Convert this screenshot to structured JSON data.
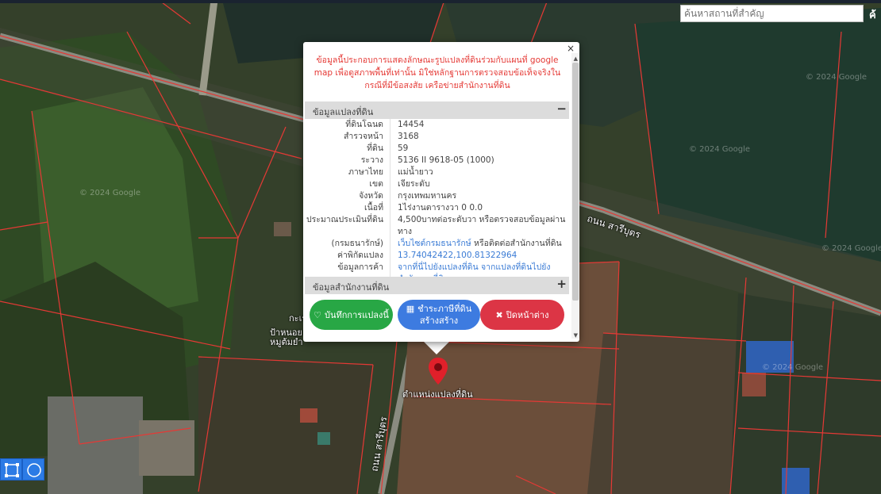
{
  "search": {
    "placeholder": "ค้นหาสถานที่สำคัญ",
    "button_label": "ค้"
  },
  "map": {
    "road_labels": [
      "ถนน สารีบุตร",
      "ถนน สารีบุตร"
    ],
    "place_labels": [
      "ป้าหนอย",
      "หมูต้มยำ",
      "กะเร"
    ],
    "watermarks": [
      "© 2024 Google",
      "© 2024 Google",
      "© 2024 Google",
      "© 2024 Google",
      "© 2024 Google"
    ],
    "marker_label": "ตำแหน่งแปลงที่ดิน"
  },
  "tools": {
    "rect_icon": "square-draw-icon",
    "circle_icon": "circle-draw-icon"
  },
  "popup": {
    "close_label": "×",
    "disclaimer": "ข้อมูลนี้ประกอบการแสดงลักษณะรูปแปลงที่ดินร่วมกับแผนที่ google map เพื่อดูสภาพพื้นที่เท่านั้น มิใช่หลักฐานการตรวจสอบข้อเท็จจริงในกรณีที่มีข้อสงสัย เครือข่ายสำนักงานที่ดิน",
    "section1_title": "ข้อมูลแปลงที่ดิน",
    "section1_toggle": "−",
    "section2_title": "ข้อมูลสำนักงานที่ดิน",
    "section2_toggle": "+",
    "rows": [
      {
        "label": "ที่ดินโฉนด",
        "value": "14454"
      },
      {
        "label": "สำรวจหน้า",
        "value": "3168"
      },
      {
        "label": "ที่ดิน",
        "value": "59"
      },
      {
        "label": "ระวาง",
        "value": "5136 II 9618-05 (1000)"
      },
      {
        "label": "ภาษาไทย",
        "value": "แม่น้ำยาว"
      },
      {
        "label": "เขต",
        "value": "เจียระดับ"
      },
      {
        "label": "จังหวัด",
        "value": "กรุงเทพมหานคร"
      },
      {
        "label": "เนื้อที่",
        "value": "1ไร่งานตารางวา 0 0.0"
      },
      {
        "label": "ประมาณประเมินที่ดิน",
        "value": "4,500บาทต่อระดับวา หรือตรวจสอบข้อมูลผ่านทาง"
      },
      {
        "label": "(กรมธนารักษ์)",
        "value": "หรือติดต่อสำนักงานที่ดิน",
        "link": "เว็บไซต์กรมธนารักษ์"
      },
      {
        "label": "ค่าพิกัดแปลง",
        "value": "",
        "link": "13.74042422,100.81322964"
      },
      {
        "label": "ข้อมูลการค้า",
        "value": "",
        "link": "จากที่นี่ไปยังแปลงที่ดิน จากแปลงที่ดินไปยัง"
      },
      {
        "label": "",
        "value": "",
        "link": "สำนักงานที่ดิน"
      }
    ],
    "buttons": {
      "save": "บันทึกการแปลงนี้",
      "pay_line1": "ชำระภาษีที่ดิน",
      "pay_line2": "สร้างสร้าง",
      "close": "ปิดหน้าต่าง"
    }
  },
  "colors": {
    "parcel_line": "#e53935",
    "popup_red": "#e53935",
    "save": "#28a745",
    "pay": "#3d7be0",
    "close": "#dc3545"
  }
}
